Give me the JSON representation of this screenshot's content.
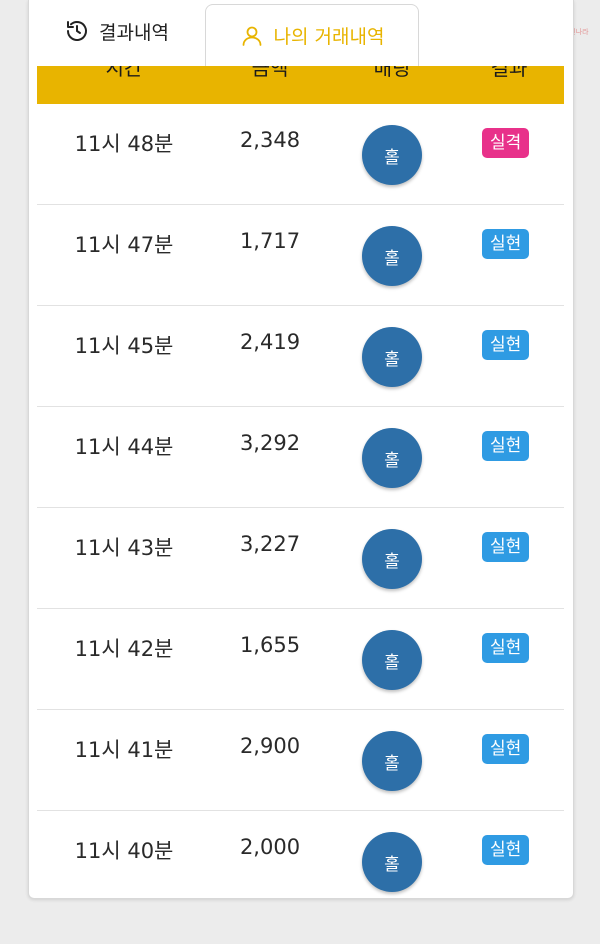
{
  "tabs": [
    {
      "label": "결과내역",
      "icon": "history-icon",
      "active": false
    },
    {
      "label": "나의 거래내역",
      "icon": "user-icon",
      "active": true
    }
  ],
  "columns": [
    "시간",
    "금액",
    "배팅",
    "결과"
  ],
  "rows": [
    {
      "time": "11시 48분",
      "amount": "2,348",
      "pick": "홀",
      "result": "실격",
      "status": "lose"
    },
    {
      "time": "11시 47분",
      "amount": "1,717",
      "pick": "홀",
      "result": "실현",
      "status": "win"
    },
    {
      "time": "11시 45분",
      "amount": "2,419",
      "pick": "홀",
      "result": "실현",
      "status": "win"
    },
    {
      "time": "11시 44분",
      "amount": "3,292",
      "pick": "홀",
      "result": "실현",
      "status": "win"
    },
    {
      "time": "11시 43분",
      "amount": "3,227",
      "pick": "홀",
      "result": "실현",
      "status": "win"
    },
    {
      "time": "11시 42분",
      "amount": "1,655",
      "pick": "홀",
      "result": "실현",
      "status": "win"
    },
    {
      "time": "11시 41분",
      "amount": "2,900",
      "pick": "홀",
      "result": "실현",
      "status": "win"
    },
    {
      "time": "11시 40분",
      "amount": "2,000",
      "pick": "홀",
      "result": "실현",
      "status": "win"
    }
  ],
  "watermark": {
    "title": "마진",
    "subtitle": "마진거래 검증커뮤니티 마진나라"
  },
  "colors": {
    "accent": "#e8b400",
    "pick_circle": "#2d6fa8",
    "badge_win": "#2f9be3",
    "badge_lose": "#e8318a"
  }
}
